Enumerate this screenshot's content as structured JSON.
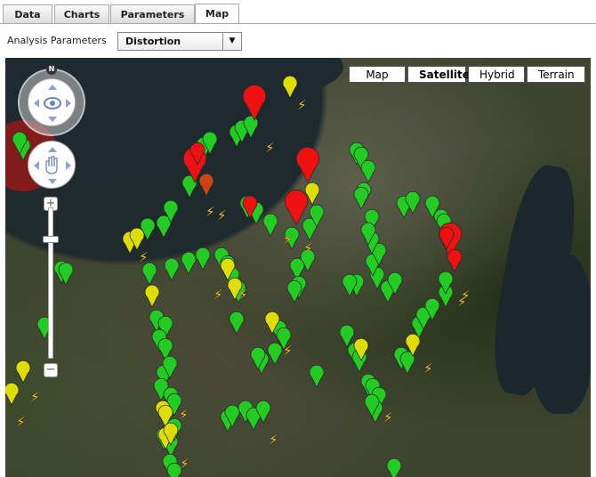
{
  "tabs": [
    {
      "label": "Data",
      "active": false
    },
    {
      "label": "Charts",
      "active": false
    },
    {
      "label": "Parameters",
      "active": false
    },
    {
      "label": "Map",
      "active": true
    }
  ],
  "analysis": {
    "label": "Analysis Parameters",
    "selected": "Distortion"
  },
  "map": {
    "types": [
      "Map",
      "Satellite",
      "Hybrid",
      "Terrain"
    ],
    "selected_type": "Satellite",
    "compass_label": "N",
    "zoom_in": "+",
    "zoom_out": "−",
    "marker_colors": {
      "green": "#22cc22",
      "yellow": "#dddd00",
      "red": "#ee1111",
      "orange": "#cc4411"
    },
    "marker_count_summary": "approx. 140 markers"
  }
}
